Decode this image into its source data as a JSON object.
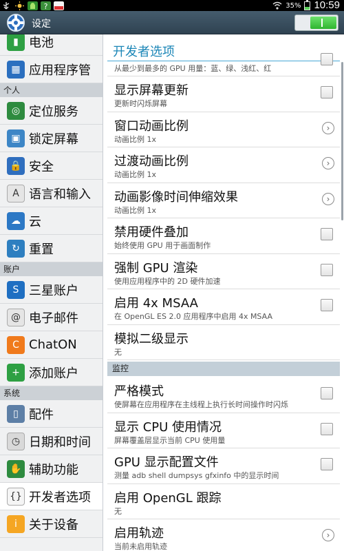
{
  "status_bar": {
    "battery_percent_text": "35%",
    "time": "10:59",
    "notif_icons": [
      "usb-icon",
      "sun-icon",
      "android-icon",
      "help-icon",
      "app-icon"
    ]
  },
  "action_bar": {
    "title": "设定",
    "developer_switch_on": true
  },
  "sidebar": {
    "items": [
      {
        "label": "电池",
        "icon": "battery-icon",
        "color": "#2ea043"
      },
      {
        "label": "应用程序管",
        "icon": "apps-grid-icon",
        "color": "#2b6fbf"
      },
      {
        "header": "个人"
      },
      {
        "label": "定位服务",
        "icon": "location-icon",
        "color": "#2e8b3f"
      },
      {
        "label": "锁定屏幕",
        "icon": "lockscreen-icon",
        "color": "#3d86c6"
      },
      {
        "label": "安全",
        "icon": "lock-icon",
        "color": "#2f6ebe"
      },
      {
        "label": "语言和输入",
        "icon": "keyboard-a-icon",
        "color": "#e5e5e5"
      },
      {
        "label": "云",
        "icon": "cloud-icon",
        "color": "#2c78c5"
      },
      {
        "label": "重置",
        "icon": "reset-icon",
        "color": "#2e7fc0"
      },
      {
        "header": "账户"
      },
      {
        "label": "三星账户",
        "icon": "samsung-s-icon",
        "color": "#1f6fc2"
      },
      {
        "label": "电子邮件",
        "icon": "email-at-icon",
        "color": "#e5e5e5"
      },
      {
        "label": "ChatON",
        "icon": "chaton-icon",
        "color": "#f07a1c"
      },
      {
        "label": "添加账户",
        "icon": "add-account-icon",
        "color": "#2ea043"
      },
      {
        "header": "系统"
      },
      {
        "label": "配件",
        "icon": "accessory-icon",
        "color": "#5d7fa6"
      },
      {
        "label": "日期和时间",
        "icon": "clock-icon",
        "color": "#d9d9d9"
      },
      {
        "label": "辅助功能",
        "icon": "hand-icon",
        "color": "#2e8b3f"
      },
      {
        "label": "开发者选项",
        "icon": "braces-icon",
        "color": "#f5f5f5",
        "selected": true
      },
      {
        "label": "关于设备",
        "icon": "info-icon",
        "color": "#f5a623"
      }
    ]
  },
  "content": {
    "title": "开发者选项",
    "items": [
      {
        "sub": "从最少到最多的 GPU 用量：蓝、绿、浅红、红",
        "control": "check",
        "partial": true
      },
      {
        "title": "显示屏幕更新",
        "sub": "更新时闪烁屏幕",
        "control": "check"
      },
      {
        "title": "窗口动画比例",
        "sub": "动画比例 1x",
        "control": "chevron"
      },
      {
        "title": "过渡动画比例",
        "sub": "动画比例 1x",
        "control": "chevron"
      },
      {
        "title": "动画影像时间伸缩效果",
        "sub": "动画比例 1x",
        "control": "chevron"
      },
      {
        "title": "禁用硬件叠加",
        "sub": "始终使用 GPU 用于画面制作",
        "control": "check"
      },
      {
        "title": "强制 GPU 渲染",
        "sub": "使用应用程序中的 2D 硬件加速",
        "control": "check"
      },
      {
        "title": "启用 4x MSAA",
        "sub": "在 OpenGL ES 2.0 应用程序中启用 4x MSAA",
        "control": "check"
      },
      {
        "title": "模拟二级显示",
        "sub": "无",
        "control": "none"
      },
      {
        "header": "监控"
      },
      {
        "title": "严格模式",
        "sub": "使屏幕在应用程序在主线程上执行长时间操作时闪烁",
        "control": "check"
      },
      {
        "title": "显示 CPU 使用情况",
        "sub": "屏幕覆盖层显示当前 CPU 使用量",
        "control": "check"
      },
      {
        "title": "GPU 显示配置文件",
        "sub": "测量 adb shell dumpsys gfxinfo 中的显示时间",
        "control": "check"
      },
      {
        "title": "启用 OpenGL 跟踪",
        "sub": "无",
        "control": "none"
      },
      {
        "title": "启用轨迹",
        "sub": "当前未启用轨迹",
        "control": "chevron"
      }
    ]
  }
}
